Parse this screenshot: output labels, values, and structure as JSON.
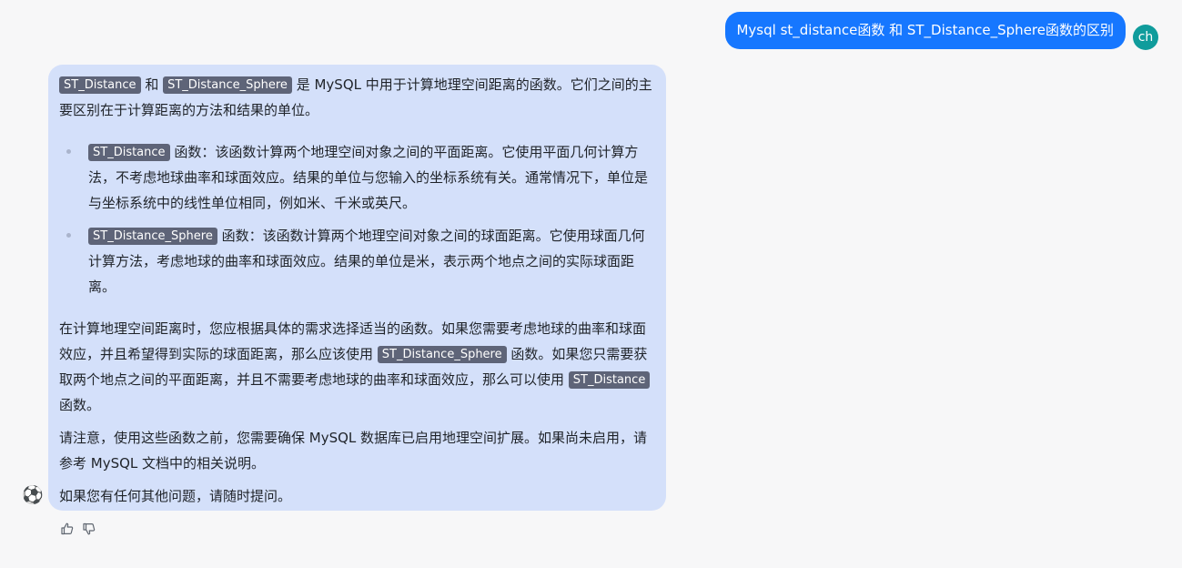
{
  "user_message": {
    "text": "Mysql st_distance函数 和 ST_Distance_Sphere函数的区别",
    "avatar_initials": "ch",
    "avatar_color": "#109c9c",
    "bubble_color": "#1677ff"
  },
  "assistant_message": {
    "avatar_emoji": "⚽",
    "bubble_color": "#d4e0fa",
    "intro": {
      "code1": "ST_Distance",
      "mid1": " 和 ",
      "code2": "ST_Distance_Sphere",
      "rest": " 是 MySQL 中用于计算地理空间距离的函数。它们之间的主要区别在于计算距离的方法和结果的单位。"
    },
    "bullets": [
      {
        "code": "ST_Distance",
        "text": " 函数：该函数计算两个地理空间对象之间的平面距离。它使用平面几何计算方法，不考虑地球曲率和球面效应。结果的单位与您输入的坐标系统有关。通常情况下，单位是与坐标系统中的线性单位相同，例如米、千米或英尺。"
      },
      {
        "code": "ST_Distance_Sphere",
        "text": " 函数：该函数计算两个地理空间对象之间的球面距离。它使用球面几何计算方法，考虑地球的曲率和球面效应。结果的单位是米，表示两个地点之间的实际球面距离。"
      }
    ],
    "recommendation": {
      "part1": "在计算地理空间距离时，您应根据具体的需求选择适当的函数。如果您需要考虑地球的曲率和球面效应，并且希望得到实际的球面距离，那么应该使用 ",
      "code1": "ST_Distance_Sphere",
      "part2": " 函数。如果您只需要获取两个地点之间的平面距离，并且不需要考虑地球的曲率和球面效应，那么可以使用 ",
      "code2": "ST_Distance",
      "part3": " 函数。"
    },
    "note": "请注意，使用这些函数之前，您需要确保 MySQL 数据库已启用地理空间扩展。如果尚未启用，请参考 MySQL 文档中的相关说明。",
    "closing": "如果您有任何其他问题，请随时提问。"
  },
  "feedback": {
    "like_icon": "thumbs-up-icon",
    "dislike_icon": "thumbs-down-icon"
  }
}
